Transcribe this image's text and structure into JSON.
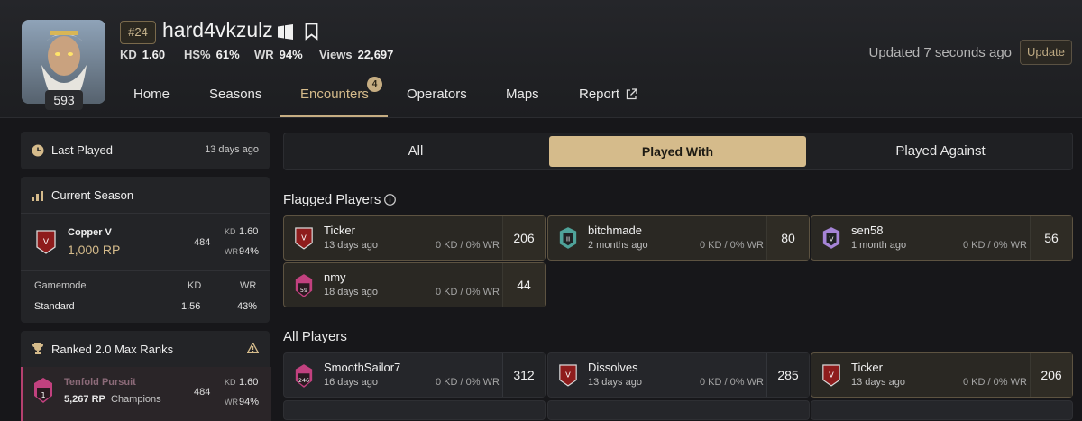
{
  "profile": {
    "level": "593",
    "rank_position": "#24",
    "username": "hard4vkzulz",
    "platform_icon": "windows-icon",
    "stats": [
      {
        "key": "KD",
        "value": "1.60"
      },
      {
        "key": "HS%",
        "value": "61%"
      },
      {
        "key": "WR",
        "value": "94%"
      },
      {
        "key": "Views",
        "value": "22,697"
      }
    ],
    "updated_text": "Updated 7 seconds ago",
    "update_button": "Update"
  },
  "nav": {
    "tabs": [
      "Home",
      "Seasons",
      "Encounters",
      "Operators",
      "Maps",
      "Report"
    ],
    "encounters_count": "4",
    "active": "Encounters"
  },
  "sidebar": {
    "last_played": {
      "label": "Last Played",
      "value": "13 days ago"
    },
    "current_season": {
      "title": "Current Season",
      "rank_name": "Copper V",
      "rp": "1,000 RP",
      "matches": "484",
      "kd_label": "KD",
      "kd": "1.60",
      "wr_label": "WR",
      "wr": "94%",
      "table_headers": [
        "Gamemode",
        "KD",
        "WR"
      ],
      "rows": [
        [
          "Standard",
          "1.56",
          "43%"
        ]
      ]
    },
    "max_ranks": {
      "title": "Ranked 2.0 Max Ranks",
      "season_name": "Tenfold Pursuit",
      "rp": "5,267 RP",
      "rank_name": "Champions",
      "rank_number": "1",
      "matches": "484",
      "kd_label": "KD",
      "kd": "1.60",
      "wr_label": "WR",
      "wr": "94%"
    }
  },
  "filters": {
    "options": [
      "All",
      "Played With",
      "Played Against"
    ],
    "selected": "Played With"
  },
  "flagged": {
    "title": "Flagged Players",
    "players": [
      {
        "name": "Ticker",
        "when": "13 days ago",
        "kdwr": "0 KD / 0% WR",
        "count": "206",
        "rank": "copper",
        "rank_label": "V"
      },
      {
        "name": "bitchmade",
        "when": "2 months ago",
        "kdwr": "0 KD / 0% WR",
        "count": "80",
        "rank": "emerald",
        "rank_label": "II"
      },
      {
        "name": "sen58",
        "when": "1 month ago",
        "kdwr": "0 KD / 0% WR",
        "count": "56",
        "rank": "diamond",
        "rank_label": "V"
      },
      {
        "name": "nmy",
        "when": "18 days ago",
        "kdwr": "0 KD / 0% WR",
        "count": "44",
        "rank": "champion",
        "rank_label": "59"
      }
    ]
  },
  "all_players": {
    "title": "All Players",
    "players": [
      {
        "name": "SmoothSailor7",
        "when": "16 days ago",
        "kdwr": "0 KD / 0% WR",
        "count": "312",
        "rank": "champion",
        "rank_label": "246"
      },
      {
        "name": "Dissolves",
        "when": "13 days ago",
        "kdwr": "0 KD / 0% WR",
        "count": "285",
        "rank": "copper",
        "rank_label": "V"
      },
      {
        "name": "Ticker",
        "when": "13 days ago",
        "kdwr": "0 KD / 0% WR",
        "count": "206",
        "rank": "copper",
        "rank_label": "V"
      }
    ]
  },
  "colors": {
    "accent": "#d5bb8b",
    "copper": "#8e1c1c",
    "emerald": "#4fa39a",
    "diamond": "#a584d6",
    "champion": "#c2417f"
  }
}
